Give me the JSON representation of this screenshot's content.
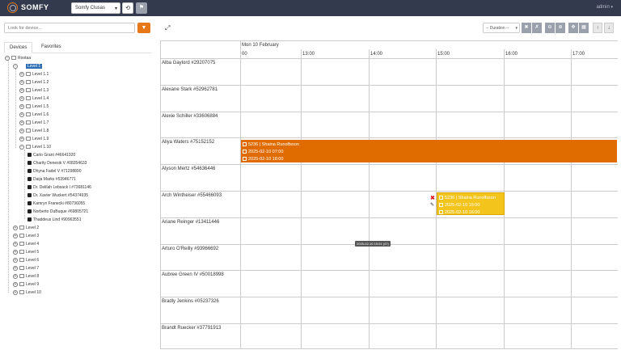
{
  "header": {
    "brand": "SOMFY",
    "site_select": "Somfy Clusas",
    "user": "admin"
  },
  "sidebar": {
    "search_placeholder": "Look for device...",
    "tabs": [
      "Devices",
      "Favorites"
    ],
    "tree": {
      "root": "Rootaa",
      "level1": "Level 1",
      "sublevels": [
        "Level 1.1",
        "Level 1.2",
        "Level 1.3",
        "Level 1.4",
        "Level 1.5",
        "Level 1.6",
        "Level 1.7",
        "Level 1.8",
        "Level 1.9",
        "Level 1.10"
      ],
      "devices": [
        "Carlo Grant #46641920",
        "Charity Denesik V #08354633",
        "Dhyna Fadel V #71298890",
        "Daija Marks #53946771",
        "Dr. Delilah Lebsack I #73681146",
        "Dr. Xavier Wuckert #54374935",
        "Kamryn Franecki #80736055",
        "Norberto DuBuque #69805721",
        "Thaddeus Lind #90963551"
      ],
      "levels": [
        "Level 2",
        "Level 3",
        "Level 4",
        "Level 5",
        "Level 6",
        "Level 7",
        "Level 8",
        "Level 9",
        "Level 10"
      ]
    }
  },
  "scheduler": {
    "duration_select": "-- Duration --",
    "date": "Mon 10 February",
    "hours": [
      "00",
      "13:00",
      "14:00",
      "15:00",
      "16:00",
      "17:00"
    ],
    "resources": [
      "Alba Gaylord #29207075",
      "Alexane Stark #52962781",
      "Alexie Schiller #33606884",
      "Aliya Waters #75152152",
      "Alyson Mertz #54636446",
      "Arch Wintheiser #55466093",
      "Ariane Reinger #13411446",
      "Arturo O'Reilly #93966692",
      "Aubree Green IV #50018998",
      "Bradly Jenkins #05237326",
      "Brandt Ruecker #37791913"
    ],
    "events": [
      {
        "title": "5236 | Shaina Runolfsson",
        "start": "2025-02-10 07:00",
        "end": "2025-02-10 18:00",
        "color": "#e06c00"
      },
      {
        "title": "5236 | Shaina Runolfsson",
        "start": "2025-02-10 15:00",
        "end": "2025-02-10 16:00",
        "color": "#f2c41c"
      }
    ],
    "now_marker": "2025-02-10 15:01 (47)"
  }
}
